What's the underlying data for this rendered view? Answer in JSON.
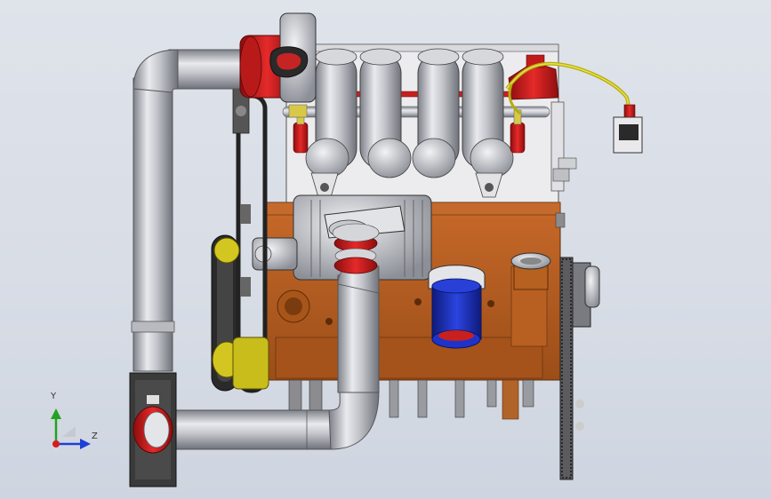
{
  "viewport": {
    "background": "#dbe0e8"
  },
  "triad": {
    "y_label": "Y",
    "z_label": "Z",
    "y_color": "#21a321",
    "z_color": "#1f3fd6",
    "origin_color": "#d81c1c"
  },
  "colors": {
    "block": "#b05a1c",
    "block_dark": "#7a3b10",
    "pipe": "#c6c8ce",
    "pipe_dark": "#8b8e96",
    "accent_red": "#d81c1c",
    "oil_filter": "#1b2fb8",
    "wire": "#c9c21a",
    "belt": "#2a2a2a"
  }
}
